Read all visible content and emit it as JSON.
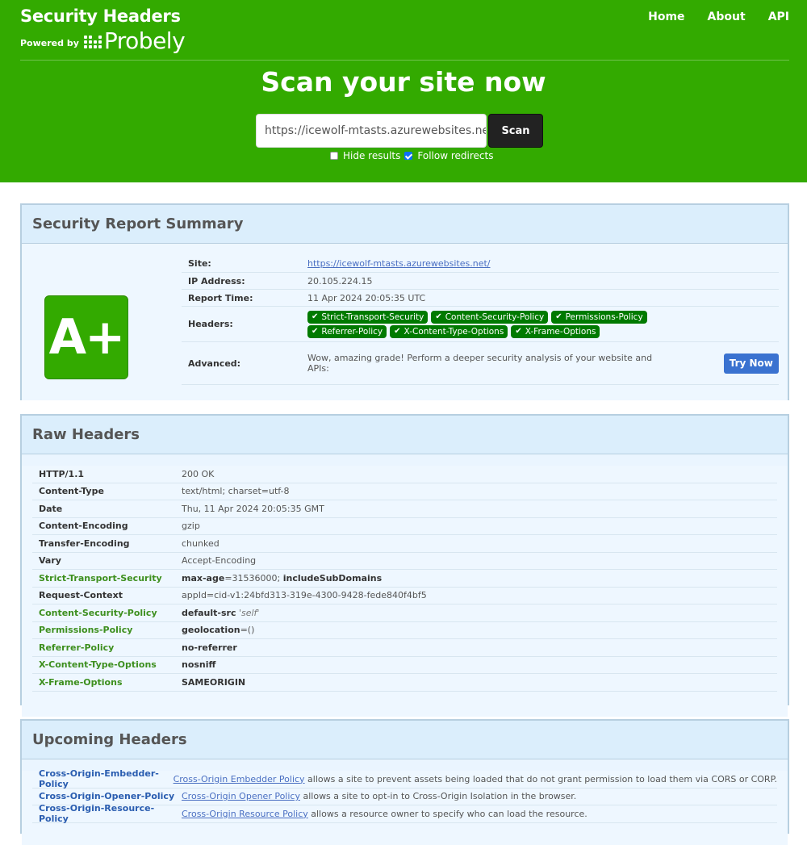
{
  "header": {
    "title": "Security Headers",
    "powered_by": "Powered by",
    "brand": "Probely",
    "nav": [
      "Home",
      "About",
      "API"
    ]
  },
  "scan": {
    "heading": "Scan your site now",
    "url_value": "https://icewolf-mtasts.azurewebsites.net",
    "button": "Scan",
    "hide_results_label": "Hide results",
    "hide_results_checked": false,
    "follow_redirects_label": "Follow redirects",
    "follow_redirects_checked": true
  },
  "summary": {
    "title": "Security Report Summary",
    "grade": "A+",
    "site_label": "Site:",
    "site_value": "https://icewolf-mtasts.azurewebsites.net/",
    "ip_label": "IP Address:",
    "ip_value": "20.105.224.15",
    "time_label": "Report Time:",
    "time_value": "11 Apr 2024 20:05:35 UTC",
    "headers_label": "Headers:",
    "badges": [
      "Strict-Transport-Security",
      "Content-Security-Policy",
      "Permissions-Policy",
      "Referrer-Policy",
      "X-Content-Type-Options",
      "X-Frame-Options"
    ],
    "advanced_label": "Advanced:",
    "advanced_text": "Wow, amazing grade! Perform a deeper security analysis of your website and APIs:",
    "try_button": "Try Now"
  },
  "raw": {
    "title": "Raw Headers",
    "rows": [
      {
        "k": "HTTP/1.1",
        "v": "200 OK",
        "green": false
      },
      {
        "k": "Content-Type",
        "v": "text/html; charset=utf-8",
        "green": false
      },
      {
        "k": "Date",
        "v": "Thu, 11 Apr 2024 20:05:35 GMT",
        "green": false
      },
      {
        "k": "Content-Encoding",
        "v": "gzip",
        "green": false
      },
      {
        "k": "Transfer-Encoding",
        "v": "chunked",
        "green": false
      },
      {
        "k": "Vary",
        "v": "Accept-Encoding",
        "green": false
      },
      {
        "k": "Strict-Transport-Security",
        "v1": "max-age",
        "v2": "=31536000; ",
        "v3": "includeSubDomains",
        "green": true
      },
      {
        "k": "Request-Context",
        "v": "appId=cid-v1:24bfd313-319e-4300-9428-fede840f4bf5",
        "green": false
      },
      {
        "k": "Content-Security-Policy",
        "v1": "default-src",
        "v2": " ",
        "v3": "'self'",
        "green": true
      },
      {
        "k": "Permissions-Policy",
        "v1": "geolocation",
        "v2": "=()",
        "v3": "",
        "green": true
      },
      {
        "k": "Referrer-Policy",
        "v1": "no-referrer",
        "v2": "",
        "v3": "",
        "green": true
      },
      {
        "k": "X-Content-Type-Options",
        "v1": "nosniff",
        "v2": "",
        "v3": "",
        "green": true
      },
      {
        "k": "X-Frame-Options",
        "v1": "SAMEORIGIN",
        "v2": "",
        "v3": "",
        "green": true
      }
    ]
  },
  "upcoming": {
    "title": "Upcoming Headers",
    "rows": [
      {
        "k": "Cross-Origin-Embedder-Policy",
        "link": "Cross-Origin Embedder Policy",
        "text": " allows a site to prevent assets being loaded that do not grant permission to load them via CORS or CORP."
      },
      {
        "k": "Cross-Origin-Opener-Policy",
        "link": "Cross-Origin Opener Policy",
        "text": " allows a site to opt-in to Cross-Origin Isolation in the browser."
      },
      {
        "k": "Cross-Origin-Resource-Policy",
        "link": "Cross-Origin Resource Policy",
        "text": " allows a resource owner to specify who can load the resource."
      }
    ]
  }
}
